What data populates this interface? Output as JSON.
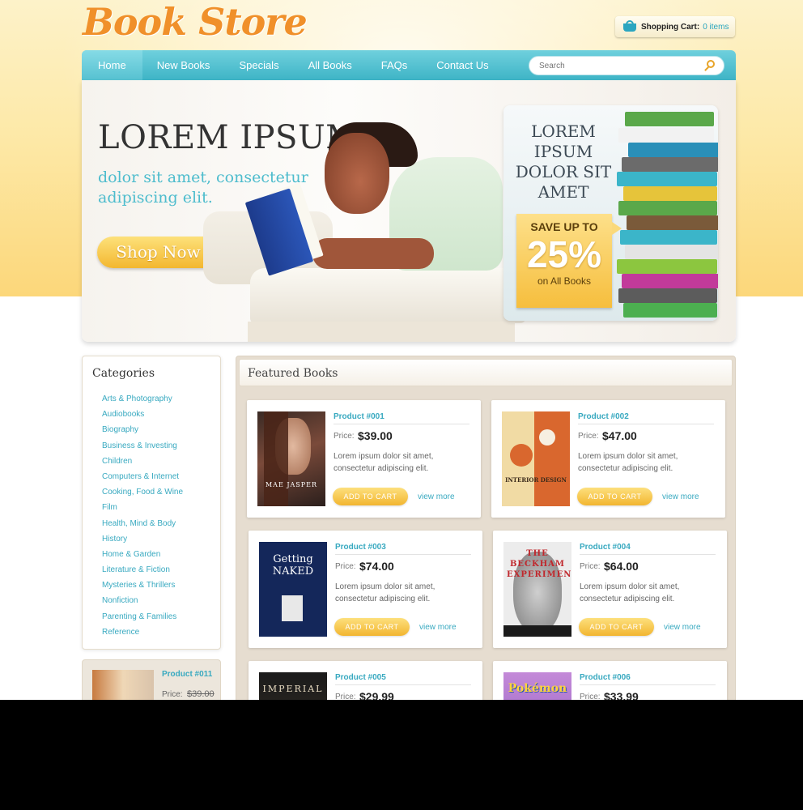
{
  "header": {
    "logo_text": "Book Store",
    "cart_label": "Shopping Cart:",
    "cart_count": "0 items"
  },
  "nav": {
    "items": [
      "Home",
      "New Books",
      "Specials",
      "All Books",
      "FAQs",
      "Contact Us"
    ],
    "active": "Home",
    "search_placeholder": "Search"
  },
  "hero": {
    "title": "LOREM IPSUM",
    "subtitle": "dolor sit amet, consectetur adipiscing elit.",
    "button_label": "Shop Now",
    "promo": {
      "title": "LOREM IPSUM DOLOR SIT AMET",
      "save_label": "SAVE UP TO",
      "percent": "25%",
      "note": "on All Books"
    }
  },
  "sidebar": {
    "title": "Categories",
    "categories": [
      "Arts & Photography",
      "Audiobooks",
      "Biography",
      "Business & Investing",
      "Children",
      "Computers & Internet",
      "Cooking, Food & Wine",
      "Film",
      "Health, Mind & Body",
      "History",
      "Home & Garden",
      "Literature & Fiction",
      "Mysteries & Thrillers",
      "Nonfiction",
      "Parenting & Families",
      "Reference"
    ],
    "featured": {
      "name": "Product #011",
      "price_label": "Price:",
      "price": "$39.00"
    }
  },
  "main": {
    "title": "Featured Books",
    "price_label": "Price:",
    "add_label": "ADD TO CART",
    "more_label": "view more",
    "products": [
      {
        "name": "Product #001",
        "price": "$39.00",
        "desc": "Lorem ipsum dolor sit amet, consectetur adipiscing elit.",
        "cover_text": "MAE JASPER"
      },
      {
        "name": "Product #002",
        "price": "$47.00",
        "desc": "Lorem ipsum dolor sit amet, consectetur adipiscing elit.",
        "cover_text": "INTERIOR DESIGN"
      },
      {
        "name": "Product #003",
        "price": "$74.00",
        "desc": "Lorem ipsum dolor sit amet, consectetur adipiscing elit.",
        "cover_text": "Getting NAKED"
      },
      {
        "name": "Product #004",
        "price": "$64.00",
        "desc": "Lorem ipsum dolor sit amet, consectetur adipiscing elit.",
        "cover_text": "THE BECKHAM EXPERIMENT"
      },
      {
        "name": "Product #005",
        "price": "$29.99",
        "desc": "",
        "cover_text": "IMPERIAL"
      },
      {
        "name": "Product #006",
        "price": "$33.99",
        "desc": "",
        "cover_text": "Pokémon"
      }
    ]
  },
  "colors": {
    "accent": "#38a9c0",
    "nav": "#3eb4c6",
    "button": "#f2b530",
    "logo": "#f0902a"
  }
}
